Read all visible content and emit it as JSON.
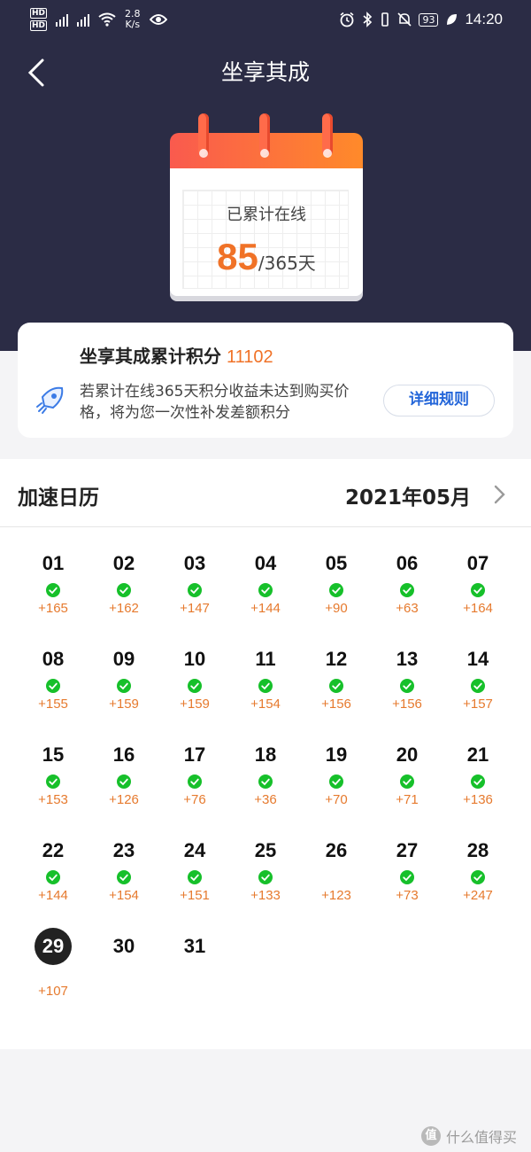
{
  "status_bar": {
    "network_speed_value": "2.8",
    "network_speed_unit": "K/s",
    "battery": "93",
    "time": "14:20"
  },
  "header": {
    "title": "坐享其成"
  },
  "calendar_badge": {
    "label": "已累计在线",
    "days_online": "85",
    "days_total": "/365天"
  },
  "points_card": {
    "title": "坐享其成累计积分",
    "points": "11102",
    "description": "若累计在线365天积分收益未达到购买价格，将为您一次性补发差额积分",
    "rules_button": "详细规则"
  },
  "calendar": {
    "title": "加速日历",
    "month": "2021年05月",
    "days": [
      {
        "date": "01",
        "checked": true,
        "gain": "+165"
      },
      {
        "date": "02",
        "checked": true,
        "gain": "+162"
      },
      {
        "date": "03",
        "checked": true,
        "gain": "+147"
      },
      {
        "date": "04",
        "checked": true,
        "gain": "+144"
      },
      {
        "date": "05",
        "checked": true,
        "gain": "+90"
      },
      {
        "date": "06",
        "checked": true,
        "gain": "+63"
      },
      {
        "date": "07",
        "checked": true,
        "gain": "+164"
      },
      {
        "date": "08",
        "checked": true,
        "gain": "+155"
      },
      {
        "date": "09",
        "checked": true,
        "gain": "+159"
      },
      {
        "date": "10",
        "checked": true,
        "gain": "+159"
      },
      {
        "date": "11",
        "checked": true,
        "gain": "+154"
      },
      {
        "date": "12",
        "checked": true,
        "gain": "+156"
      },
      {
        "date": "13",
        "checked": true,
        "gain": "+156"
      },
      {
        "date": "14",
        "checked": true,
        "gain": "+157"
      },
      {
        "date": "15",
        "checked": true,
        "gain": "+153"
      },
      {
        "date": "16",
        "checked": true,
        "gain": "+126"
      },
      {
        "date": "17",
        "checked": true,
        "gain": "+76"
      },
      {
        "date": "18",
        "checked": true,
        "gain": "+36"
      },
      {
        "date": "19",
        "checked": true,
        "gain": "+70"
      },
      {
        "date": "20",
        "checked": true,
        "gain": "+71"
      },
      {
        "date": "21",
        "checked": true,
        "gain": "+136"
      },
      {
        "date": "22",
        "checked": true,
        "gain": "+144"
      },
      {
        "date": "23",
        "checked": true,
        "gain": "+154"
      },
      {
        "date": "24",
        "checked": true,
        "gain": "+151"
      },
      {
        "date": "25",
        "checked": true,
        "gain": "+133"
      },
      {
        "date": "26",
        "checked": false,
        "gain": "+123"
      },
      {
        "date": "27",
        "checked": true,
        "gain": "+73"
      },
      {
        "date": "28",
        "checked": true,
        "gain": "+247"
      },
      {
        "date": "29",
        "checked": false,
        "gain": "+107",
        "today": true
      },
      {
        "date": "30",
        "checked": false,
        "gain": ""
      },
      {
        "date": "31",
        "checked": false,
        "gain": ""
      }
    ]
  },
  "watermark": {
    "logo": "值",
    "text": "什么值得买"
  },
  "colors": {
    "header_bg": "#2b2c45",
    "accent_orange": "#f07227",
    "check_green": "#16c02a",
    "link_blue": "#2466d9"
  },
  "icons": [
    "back-arrow-icon",
    "rocket-icon",
    "chevron-right-icon",
    "check-circle-icon",
    "calendar-illustration",
    "eye-icon",
    "wifi-icon",
    "alarm-icon",
    "bluetooth-icon",
    "vibrate-icon",
    "mute-icon",
    "leaf-icon"
  ]
}
